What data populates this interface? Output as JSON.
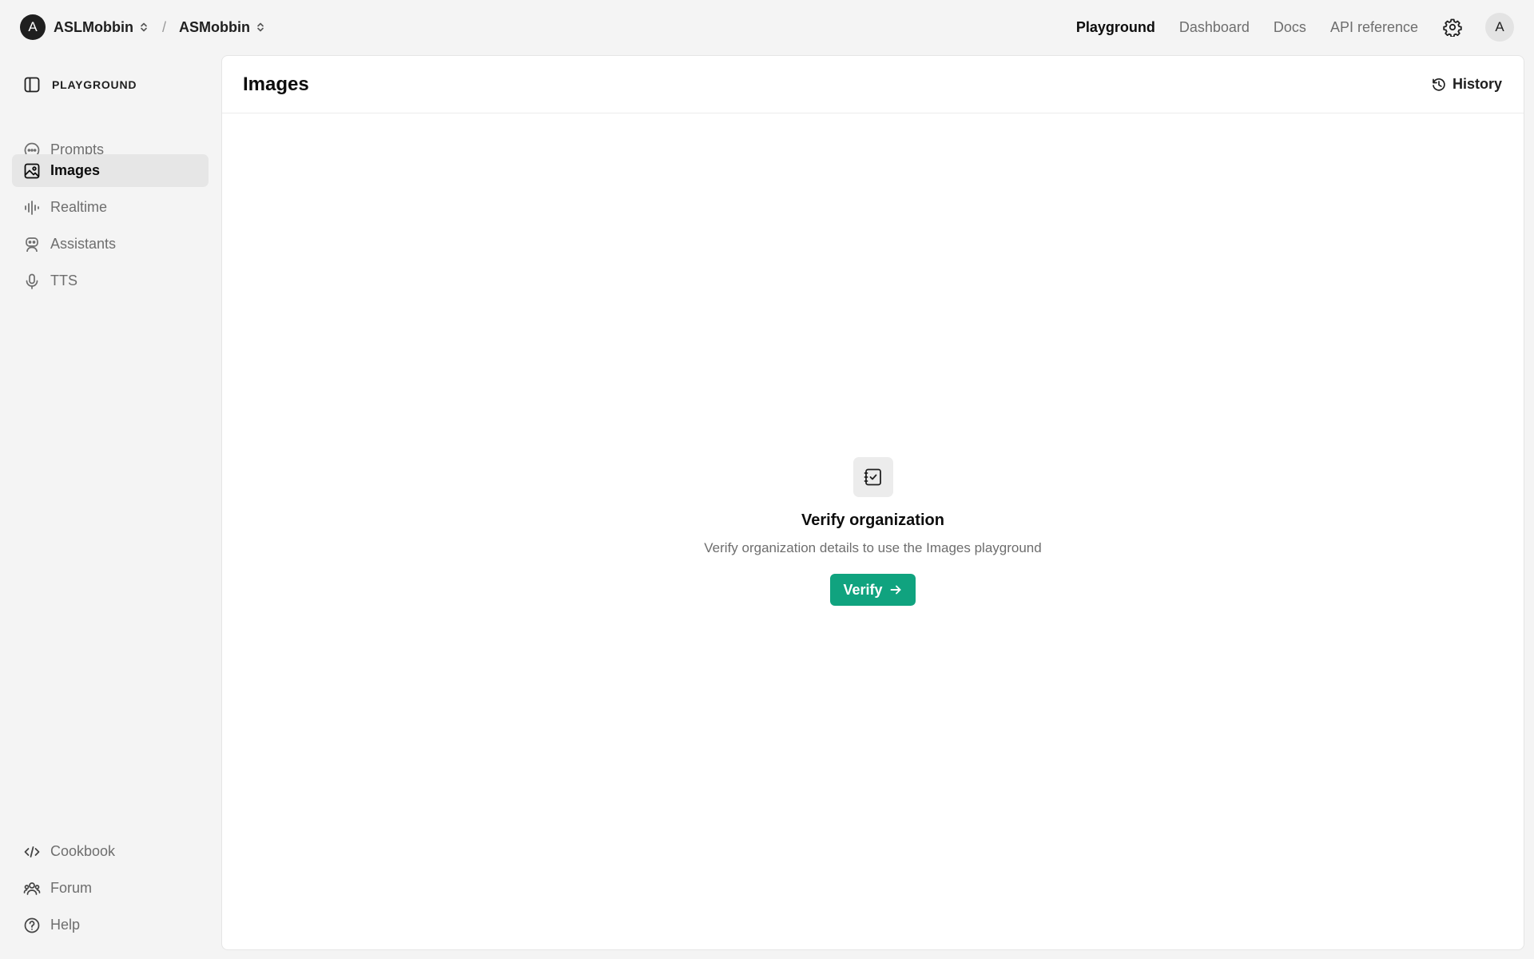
{
  "topbar": {
    "org_avatar_letter": "A",
    "org_name": "ASLMobbin",
    "separator": "/",
    "project_name": "ASMobbin",
    "nav": [
      {
        "label": "Playground",
        "active": true
      },
      {
        "label": "Dashboard",
        "active": false
      },
      {
        "label": "Docs",
        "active": false
      },
      {
        "label": "API reference",
        "active": false
      }
    ],
    "user_avatar_letter": "A"
  },
  "sidebar": {
    "header": "PLAYGROUND",
    "items": [
      {
        "label": "Prompts",
        "icon": "chat-bubble-icon",
        "active": false
      },
      {
        "label": "Images",
        "icon": "image-icon",
        "active": true
      },
      {
        "label": "Realtime",
        "icon": "audio-wave-icon",
        "active": false
      },
      {
        "label": "Assistants",
        "icon": "robot-icon",
        "active": false
      },
      {
        "label": "TTS",
        "icon": "microphone-icon",
        "active": false
      }
    ],
    "footer": [
      {
        "label": "Cookbook",
        "icon": "code-icon"
      },
      {
        "label": "Forum",
        "icon": "people-icon"
      },
      {
        "label": "Help",
        "icon": "help-circle-icon"
      }
    ]
  },
  "main": {
    "title": "Images",
    "history_label": "History",
    "empty_state": {
      "icon": "verified-document-icon",
      "title": "Verify organization",
      "description": "Verify organization details to use the Images playground",
      "button_label": "Verify"
    }
  },
  "colors": {
    "accent": "#10a37f",
    "page_bg": "#f4f4f4",
    "active_item_bg": "#e6e6e6",
    "muted_text": "#6e6e6e"
  }
}
